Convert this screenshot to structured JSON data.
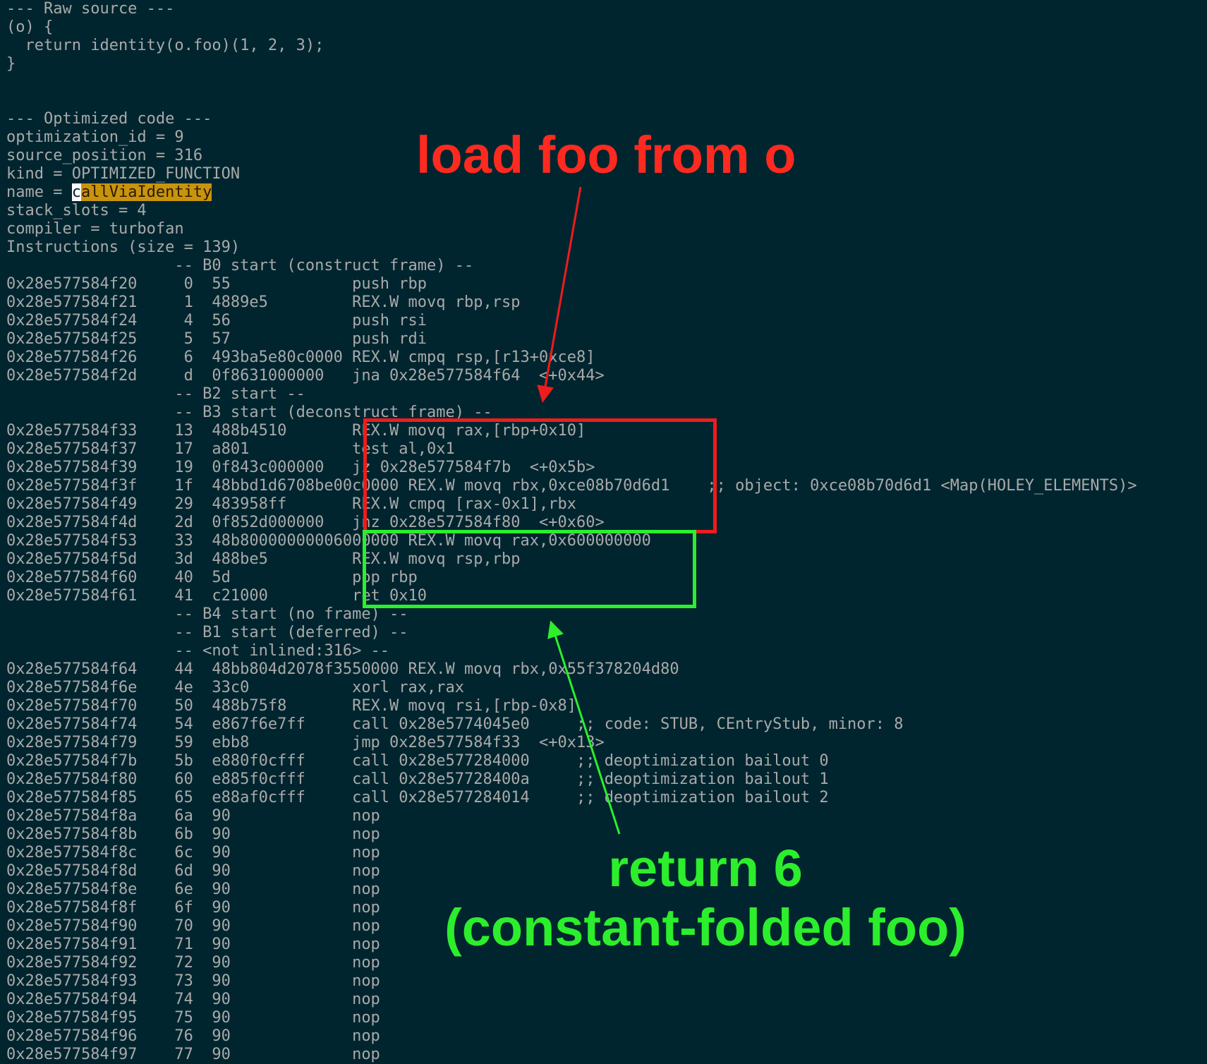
{
  "terminal": {
    "lines": [
      "--- Raw source ---",
      "(o) {",
      "  return identity(o.foo)(1, 2, 3);",
      "}",
      "",
      "",
      "--- Optimized code ---",
      "optimization_id = 9",
      "source_position = 316",
      "kind = OPTIMIZED_FUNCTION",
      "",
      "stack_slots = 4",
      "compiler = turbofan",
      "Instructions (size = 139)",
      "                  -- B0 start (construct frame) --",
      "0x28e577584f20     0  55             push rbp",
      "0x28e577584f21     1  4889e5         REX.W movq rbp,rsp",
      "0x28e577584f24     4  56             push rsi",
      "0x28e577584f25     5  57             push rdi",
      "0x28e577584f26     6  493ba5e80c0000 REX.W cmpq rsp,[r13+0xce8]",
      "0x28e577584f2d     d  0f8631000000   jna 0x28e577584f64  <+0x44>",
      "                  -- B2 start --",
      "                  -- B3 start (deconstruct frame) --",
      "0x28e577584f33    13  488b4510       REX.W movq rax,[rbp+0x10]",
      "0x28e577584f37    17  a801           test al,0x1",
      "0x28e577584f39    19  0f843c000000   jz 0x28e577584f7b  <+0x5b>",
      "0x28e577584f3f    1f  48bbd1d6708be00c0000 REX.W movq rbx,0xce08b70d6d1    ;; object: 0xce08b70d6d1 <Map(HOLEY_ELEMENTS)>",
      "0x28e577584f49    29  483958ff       REX.W cmpq [rax-0x1],rbx",
      "0x28e577584f4d    2d  0f852d000000   jnz 0x28e577584f80  <+0x60>",
      "0x28e577584f53    33  48b80000000006000000 REX.W movq rax,0x600000000",
      "0x28e577584f5d    3d  488be5         REX.W movq rsp,rbp",
      "0x28e577584f60    40  5d             pop rbp",
      "0x28e577584f61    41  c21000         ret 0x10",
      "                  -- B4 start (no frame) --",
      "                  -- B1 start (deferred) --",
      "                  -- <not inlined:316> --",
      "0x28e577584f64    44  48bb804d2078f3550000 REX.W movq rbx,0x55f378204d80",
      "0x28e577584f6e    4e  33c0           xorl rax,rax",
      "0x28e577584f70    50  488b75f8       REX.W movq rsi,[rbp-0x8]",
      "0x28e577584f74    54  e867f6e7ff     call 0x28e5774045e0     ;; code: STUB, CEntryStub, minor: 8",
      "0x28e577584f79    59  ebb8           jmp 0x28e577584f33  <+0x13>",
      "0x28e577584f7b    5b  e880f0cfff     call 0x28e577284000     ;; deoptimization bailout 0",
      "0x28e577584f80    60  e885f0cfff     call 0x28e57728400a     ;; deoptimization bailout 1",
      "0x28e577584f85    65  e88af0cfff     call 0x28e577284014     ;; deoptimization bailout 2",
      "0x28e577584f8a    6a  90             nop",
      "0x28e577584f8b    6b  90             nop",
      "0x28e577584f8c    6c  90             nop",
      "0x28e577584f8d    6d  90             nop",
      "0x28e577584f8e    6e  90             nop",
      "0x28e577584f8f    6f  90             nop",
      "0x28e577584f90    70  90             nop",
      "0x28e577584f91    71  90             nop",
      "0x28e577584f92    72  90             nop",
      "0x28e577584f93    73  90             nop",
      "0x28e577584f94    74  90             nop",
      "0x28e577584f95    75  90             nop",
      "0x28e577584f96    76  90             nop",
      "0x28e577584f97    77  90             nop"
    ],
    "name_line": {
      "prefix": "name = ",
      "selection_first_char": "c",
      "selection_rest": "allViaIdentity"
    }
  },
  "annotations": {
    "load": "load foo from o",
    "return_line1": "return 6",
    "return_line2": "(constant-folded foo)"
  },
  "colors": {
    "background": "#00252f",
    "text": "#a9a9a9",
    "red_annotation": "#ee1c1c",
    "green_annotation": "#2cee2c",
    "selection_highlight": "#c8940c"
  }
}
